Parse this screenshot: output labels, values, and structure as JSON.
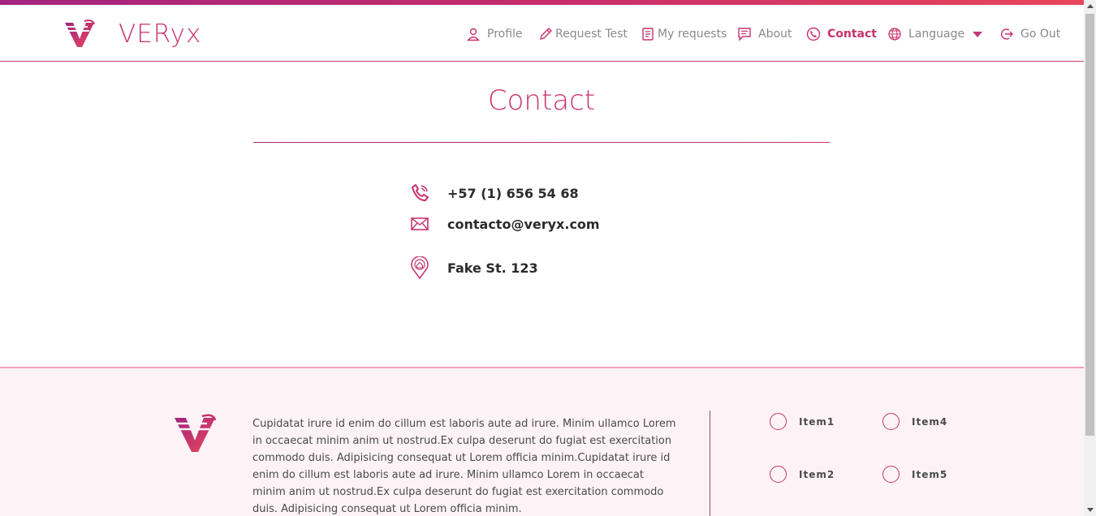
{
  "header": {
    "brand": "VERyx",
    "nav": [
      {
        "label": "Profile",
        "icon": "user-icon"
      },
      {
        "label": "Request Test",
        "icon": "pencil-icon"
      },
      {
        "label": "My requests",
        "icon": "requests-icon"
      },
      {
        "label": "About",
        "icon": "chat-icon"
      },
      {
        "label": "Contact",
        "icon": "phone-icon",
        "active": true
      },
      {
        "label": "Language",
        "icon": "globe-icon"
      },
      {
        "label": "Go Out",
        "icon": "logout-icon"
      }
    ]
  },
  "main": {
    "title": "Contact",
    "phone": "+57 (1) 656 54 68",
    "email": "contacto@veryx.com",
    "address": "Fake St. 123"
  },
  "footer": {
    "text": "Cupidatat irure id enim do cillum est laboris aute ad irure. Minim ullamco Lorem in occaecat minim anim ut nostrud.Ex culpa deserunt do fugiat est exercitation commodo duis. Adipisicing consequat ut Lorem officia minim.Cupidatat irure id enim do cillum est laboris aute ad irure. Minim ullamco Lorem in occaecat minim anim ut nostrud.Ex culpa deserunt do fugiat est exercitation commodo duis. Adipisicing consequat ut Lorem officia minim.",
    "items": [
      "Item1",
      "Item4",
      "Item2",
      "Item5"
    ]
  },
  "colors": {
    "accent": "#c8336b",
    "accent_dark": "#a3247f",
    "footer_bg": "#fdf3f6",
    "nav_text": "#8a8a8a"
  }
}
